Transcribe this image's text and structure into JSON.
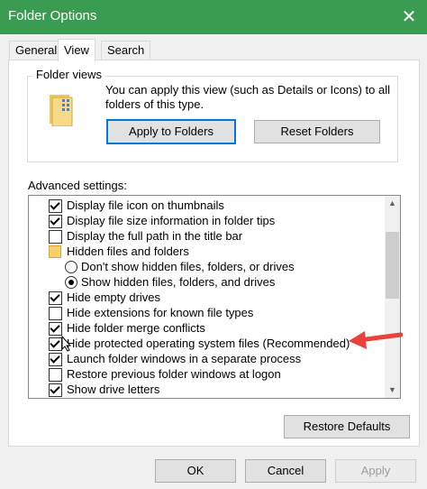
{
  "window": {
    "title": "Folder Options",
    "close_label": "✕"
  },
  "tabs": [
    {
      "label": "General",
      "active": false
    },
    {
      "label": "View",
      "active": true
    },
    {
      "label": "Search",
      "active": false
    }
  ],
  "folder_views": {
    "group_label": "Folder views",
    "description": "You can apply this view (such as Details or Icons) to all folders of this type.",
    "apply_button": "Apply to Folders",
    "reset_button": "Reset Folders"
  },
  "advanced": {
    "label": "Advanced settings:",
    "items": [
      {
        "label": "Display file icon on thumbnails",
        "kind": "checkbox",
        "checked": true
      },
      {
        "label": "Display file size information in folder tips",
        "kind": "checkbox",
        "checked": true
      },
      {
        "label": "Display the full path in the title bar",
        "kind": "checkbox",
        "checked": false
      },
      {
        "label": "Hidden files and folders",
        "kind": "folder"
      },
      {
        "label": "Don't show hidden files, folders, or drives",
        "kind": "radio",
        "checked": false
      },
      {
        "label": "Show hidden files, folders, and drives",
        "kind": "radio",
        "checked": true
      },
      {
        "label": "Hide empty drives",
        "kind": "checkbox",
        "checked": true
      },
      {
        "label": "Hide extensions for known file types",
        "kind": "checkbox",
        "checked": false
      },
      {
        "label": "Hide folder merge conflicts",
        "kind": "checkbox",
        "checked": true
      },
      {
        "label": "Hide protected operating system files (Recommended)",
        "kind": "checkbox",
        "checked": true
      },
      {
        "label": "Launch folder windows in a separate process",
        "kind": "checkbox",
        "checked": true
      },
      {
        "label": "Restore previous folder windows at logon",
        "kind": "checkbox",
        "checked": false
      },
      {
        "label": "Show drive letters",
        "kind": "checkbox",
        "checked": true
      }
    ],
    "restore_button": "Restore Defaults"
  },
  "footer": {
    "ok": "OK",
    "cancel": "Cancel",
    "apply": "Apply"
  },
  "colors": {
    "titlebar": "#3a9b52",
    "primary_border": "#0078d7",
    "annotation_arrow": "#e8423b"
  }
}
